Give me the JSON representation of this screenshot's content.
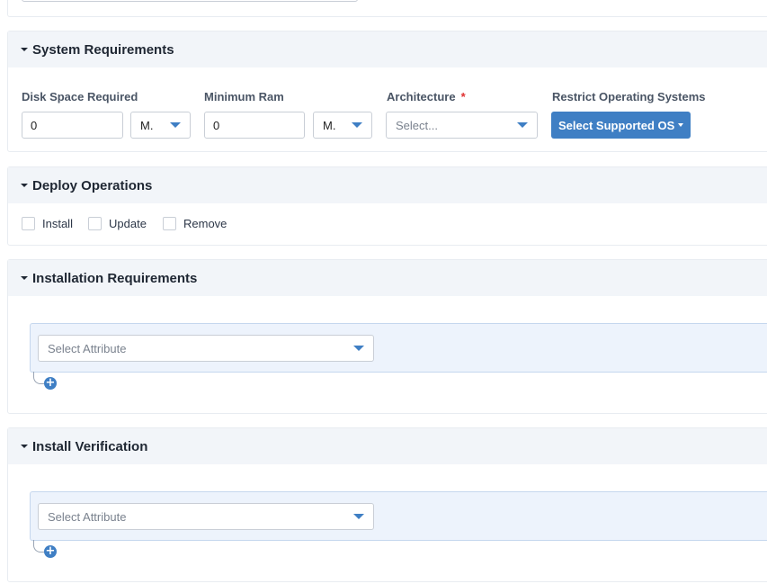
{
  "system_requirements": {
    "title": "System Requirements",
    "disk_space": {
      "label": "Disk Space Required",
      "value": "0",
      "unit": "M."
    },
    "minimum_ram": {
      "label": "Minimum Ram",
      "value": "0",
      "unit": "M."
    },
    "architecture": {
      "label": "Architecture",
      "required_mark": "*",
      "placeholder": "Select..."
    },
    "restrict_os": {
      "label": "Restrict Operating Systems",
      "button": "Select Supported OS"
    }
  },
  "deploy_operations": {
    "title": "Deploy Operations",
    "options": [
      "Install",
      "Update",
      "Remove"
    ]
  },
  "installation_requirements": {
    "title": "Installation Requirements",
    "attribute_placeholder": "Select Attribute",
    "add_symbol": "+"
  },
  "install_verification": {
    "title": "Install Verification",
    "attribute_placeholder": "Select Attribute",
    "add_symbol": "+"
  },
  "colors": {
    "accent": "#3f7fc4",
    "header_bg": "#f2f5f9",
    "attr_bg": "#edf3fc",
    "required": "#e03131"
  }
}
